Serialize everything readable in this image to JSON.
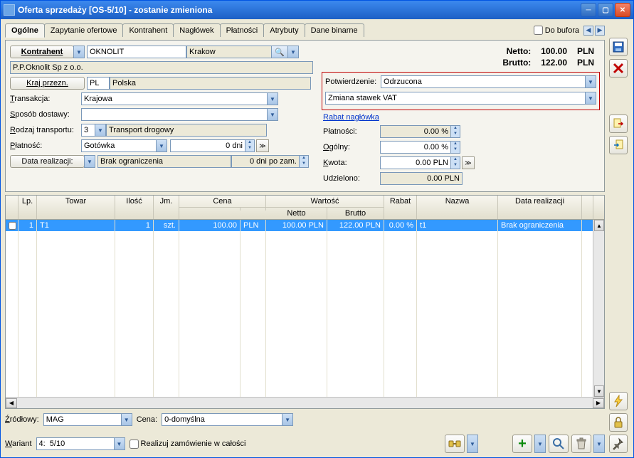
{
  "title": "Oferta sprzedaży [OS-5/10] - zostanie zmieniona",
  "bufor_label": "Do bufora",
  "tabs": [
    "Ogólne",
    "Zapytanie ofertowe",
    "Kontrahent",
    "Nagłówek",
    "Płatności",
    "Atrybuty",
    "Dane binarne"
  ],
  "form": {
    "kontrahent_btn": "Kontrahent",
    "kontrahent_val": "OKNOLIT",
    "kontrahent_city": "Krakow",
    "kontrahent_full": "P.P.Oknolit Sp z o.o.",
    "kraj_btn": "Kraj przezn.",
    "kraj_code": "PL",
    "kraj_name": "Polska",
    "transakcja_lbl": "Transakcja:",
    "transakcja_val": "Krajowa",
    "dostawa_lbl": "Sposób dostawy:",
    "dostawa_val": "",
    "transport_lbl": "Rodzaj transportu:",
    "transport_code": "3",
    "transport_name": "Transport drogowy",
    "platnosc_lbl": "Płatność:",
    "platnosc_val": "Gotówka",
    "platnosc_dni": "0 dni",
    "data_real_btn": "Data realizacji:",
    "data_real_val": "Brak ograniczenia",
    "data_real_dni": "0 dni po zam."
  },
  "totals": {
    "netto_lbl": "Netto:",
    "netto_val": "100.00",
    "brutto_lbl": "Brutto:",
    "brutto_val": "122.00",
    "cur": "PLN"
  },
  "confirm": {
    "potw_lbl": "Potwierdzenie:",
    "potw_val": "Odrzucona",
    "vat_val": "Zmiana stawek VAT"
  },
  "rabat_link": "Rabat nagłówka",
  "disc": {
    "platnosci_lbl": "Płatności:",
    "platnosci_val": "0.00 %",
    "ogolny_lbl": "Ogólny:",
    "ogolny_val": "0.00 %",
    "kwota_lbl": "Kwota:",
    "kwota_val": "0.00 PLN",
    "udzielono_lbl": "Udzielono:",
    "udzielono_val": "0.00 PLN"
  },
  "cols": {
    "lp": "Lp.",
    "towar": "Towar",
    "ilosc": "Ilość",
    "jm": "Jm.",
    "cena": "Cena",
    "wartosc": "Wartość",
    "netto": "Netto",
    "brutto": "Brutto",
    "rabat": "Rabat",
    "nazwa": "Nazwa",
    "data": "Data realizacji"
  },
  "row": {
    "lp": "1",
    "towar": "T1",
    "ilosc": "1",
    "jm": "szt.",
    "cena": "100.00",
    "cur": "PLN",
    "netto": "100.00 PLN",
    "brutto": "122.00 PLN",
    "rabat": "0.00 %",
    "nazwa": "t1",
    "data": "Brak ograniczenia"
  },
  "bottom": {
    "zrodlowy_lbl": "Źródłowy:",
    "zrodlowy_val": "MAG",
    "cena_lbl": "Cena:",
    "cena_val": "0-domyślna",
    "wariant_lbl": "Wariant",
    "wariant_val": "4:  5/10",
    "realizuj_lbl": "Realizuj zamówienie w całości"
  }
}
